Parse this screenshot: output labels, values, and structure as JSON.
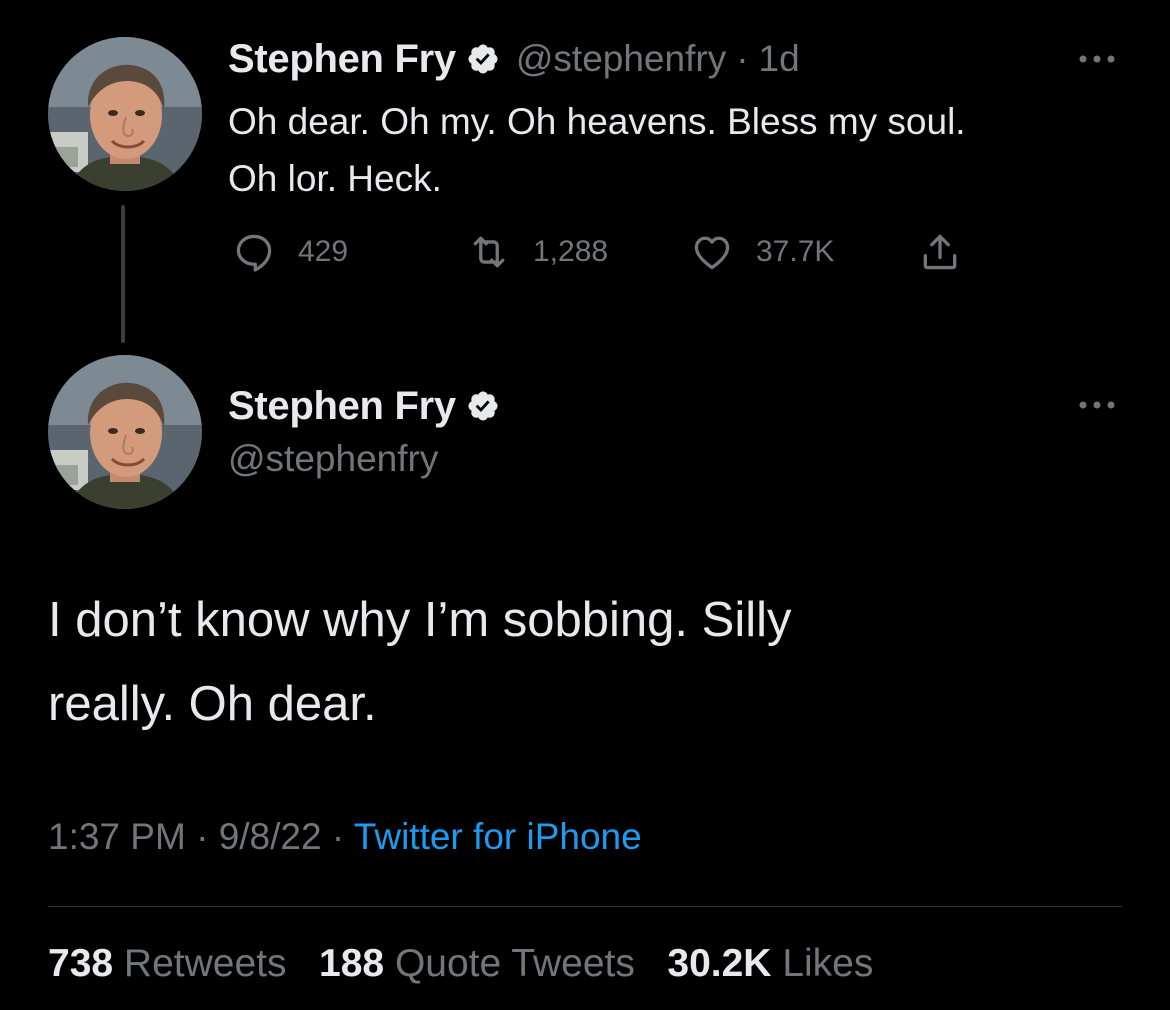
{
  "colors": {
    "background": "#000000",
    "text": "#e7e9ea",
    "muted": "#71767b",
    "link": "#1d9bf0",
    "verified_badge": "#e7e9ea"
  },
  "tweet1": {
    "author_name": "Stephen Fry",
    "handle": "@stephenfry",
    "separator": "·",
    "age": "1d",
    "text_line1": "Oh dear. Oh my. Oh heavens. Bless my soul.",
    "text_line2": "Oh lor. Heck.",
    "actions": {
      "reply_icon": "reply-icon",
      "reply_count": "429",
      "retweet_icon": "retweet-icon",
      "retweet_count": "1,288",
      "like_icon": "heart-icon",
      "like_count": "37.7K",
      "share_icon": "share-icon"
    }
  },
  "tweet2": {
    "author_name": "Stephen Fry",
    "handle": "@stephenfry",
    "text_line1": "I don’t know why I’m sobbing. Silly",
    "text_line2": "really. Oh dear.",
    "time": "1:37 PM",
    "sep1": "·",
    "date": "9/8/22",
    "sep2": "·",
    "source": "Twitter for iPhone",
    "stats": {
      "retweets_count": "738",
      "retweets_label": "Retweets",
      "quotes_count": "188",
      "quotes_label": "Quote Tweets",
      "likes_count": "30.2K",
      "likes_label": "Likes"
    }
  }
}
